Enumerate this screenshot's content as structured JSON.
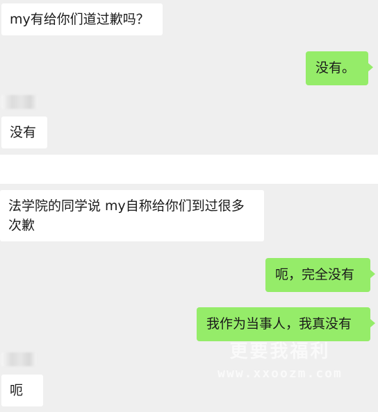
{
  "chat": {
    "messages": [
      {
        "side": "in",
        "text": "my有给你们道过歉吗？"
      },
      {
        "side": "out",
        "text": "没有。"
      },
      {
        "side": "in",
        "text": "没有"
      },
      {
        "side": "in",
        "text": "法学院的同学说 my自称给你们到过很多次歉"
      },
      {
        "side": "out",
        "text": "呃，完全没有"
      },
      {
        "side": "out",
        "text": "我作为当事人，我真没有"
      },
      {
        "side": "in",
        "text": "呃"
      }
    ]
  },
  "watermark": {
    "logo": "更要我福利",
    "url": "www.xxoozm.com"
  },
  "colors": {
    "background": "#efefef",
    "incoming_bubble": "#ffffff",
    "outgoing_bubble": "#95ec69",
    "separator": "#ffffff"
  }
}
